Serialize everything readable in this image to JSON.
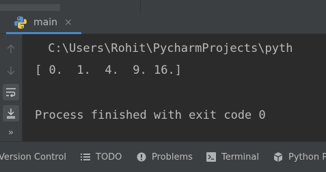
{
  "tabs": [
    {
      "label": "main",
      "close": "×",
      "icon": "python-icon",
      "active": true
    }
  ],
  "console": {
    "lines": [
      " C:\\Users\\Rohit\\PycharmProjects\\pyth",
      "[ 0.  1.  4.  9. 16.]",
      "",
      "Process finished with exit code 0"
    ]
  },
  "gutter": {
    "icons": [
      "arrow-up-icon",
      "arrow-down-icon",
      "soft-wrap-icon",
      "scroll-to-end-icon"
    ],
    "more": "»"
  },
  "toolwindows": [
    {
      "label": "Version Control",
      "icon": "version-control-icon"
    },
    {
      "label": "TODO",
      "icon": "todo-list-icon"
    },
    {
      "label": "Problems",
      "icon": "problems-icon"
    },
    {
      "label": "Terminal",
      "icon": "terminal-icon"
    },
    {
      "label": "Python Pa",
      "icon": "python-packages-icon"
    }
  ],
  "colors": {
    "background": "#2b2b2b",
    "panel": "#3c3f41",
    "text": "#bbbbbb",
    "accent": "#4a88c7"
  }
}
